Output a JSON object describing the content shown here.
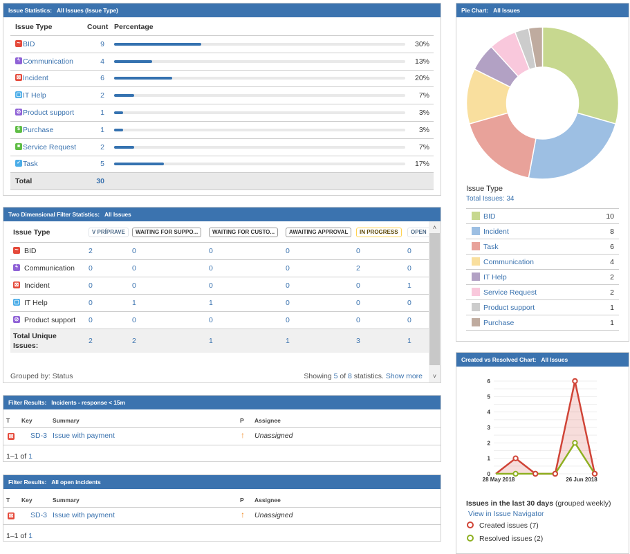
{
  "colors": {
    "header": "#3b73af",
    "link": "#3b73af",
    "bar": "#3572b0",
    "created": "#d04437",
    "resolved": "#8eb021"
  },
  "issue_statistics": {
    "title": "Issue Statistics:",
    "subtitle": "All Issues (Issue Type)",
    "columns": [
      "Issue Type",
      "Count",
      "Percentage"
    ],
    "rows": [
      {
        "type": "BID",
        "icon": "bid",
        "count": "9",
        "pct": "30%",
        "fraction": 0.3
      },
      {
        "type": "Communication",
        "icon": "communication",
        "count": "4",
        "pct": "13%",
        "fraction": 0.13
      },
      {
        "type": "Incident",
        "icon": "incident",
        "count": "6",
        "pct": "20%",
        "fraction": 0.2
      },
      {
        "type": "IT Help",
        "icon": "it-help",
        "count": "2",
        "pct": "7%",
        "fraction": 0.07
      },
      {
        "type": "Product support",
        "icon": "product-support",
        "count": "1",
        "pct": "3%",
        "fraction": 0.03
      },
      {
        "type": "Purchase",
        "icon": "purchase",
        "count": "1",
        "pct": "3%",
        "fraction": 0.03
      },
      {
        "type": "Service Request",
        "icon": "service-request",
        "count": "2",
        "pct": "7%",
        "fraction": 0.07
      },
      {
        "type": "Task",
        "icon": "task",
        "count": "5",
        "pct": "17%",
        "fraction": 0.17
      }
    ],
    "total_label": "Total",
    "total": "30"
  },
  "two_dimensional": {
    "title": "Two Dimensional Filter Statistics:",
    "subtitle": "All Issues",
    "row_header": "Issue Type",
    "statuses": [
      {
        "label": "V PRÍPRAVE",
        "style": "default"
      },
      {
        "label": "WAITING FOR SUPPO...",
        "style": "dark"
      },
      {
        "label": "WAITING FOR CUSTO...",
        "style": "dark"
      },
      {
        "label": "AWAITING APPROVAL",
        "style": "dark"
      },
      {
        "label": "IN PROGRESS",
        "style": "yellow"
      },
      {
        "label": "OPEN",
        "style": "default"
      }
    ],
    "rows": [
      {
        "type": "BID",
        "icon": "bid",
        "values": [
          "2",
          "0",
          "0",
          "0",
          "0",
          "0"
        ]
      },
      {
        "type": "Communication",
        "icon": "communication",
        "values": [
          "0",
          "0",
          "0",
          "0",
          "2",
          "0"
        ]
      },
      {
        "type": "Incident",
        "icon": "incident",
        "values": [
          "0",
          "0",
          "0",
          "0",
          "0",
          "1"
        ]
      },
      {
        "type": "IT Help",
        "icon": "it-help",
        "values": [
          "0",
          "1",
          "1",
          "0",
          "0",
          "0"
        ]
      },
      {
        "type": "Product support",
        "icon": "product-support",
        "values": [
          "0",
          "0",
          "0",
          "0",
          "0",
          "0"
        ]
      }
    ],
    "total_label_1": "Total Unique",
    "total_label_2": "Issues:",
    "totals": [
      "2",
      "2",
      "1",
      "1",
      "3",
      "1"
    ],
    "grouped_by": "Grouped by: Status",
    "showing_prefix": "Showing ",
    "showing_count": "5",
    "showing_of": " of ",
    "showing_total": "8",
    "showing_suffix": " statistics. ",
    "show_more": "Show more"
  },
  "filter_results": [
    {
      "title": "Filter Results:",
      "subtitle": "Incidents - response < 15m",
      "columns": {
        "t": "T",
        "key": "Key",
        "summary": "Summary",
        "p": "P",
        "assignee": "Assignee"
      },
      "rows": [
        {
          "icon": "incident",
          "key": "SD-3",
          "summary": "Issue with payment",
          "priority": "high",
          "assignee": "Unassigned"
        }
      ],
      "paging_range": "1–1 of ",
      "paging_total": "1"
    },
    {
      "title": "Filter Results:",
      "subtitle": "All open incidents",
      "columns": {
        "t": "T",
        "key": "Key",
        "summary": "Summary",
        "p": "P",
        "assignee": "Assignee"
      },
      "rows": [
        {
          "icon": "incident",
          "key": "SD-3",
          "summary": "Issue with payment",
          "priority": "high",
          "assignee": "Unassigned"
        }
      ],
      "paging_range": "1–1 of ",
      "paging_total": "1"
    }
  ],
  "pie_chart": {
    "title": "Pie Chart:",
    "subtitle": "All Issues",
    "legend_title": "Issue Type",
    "total_label": "Total Issues: 34",
    "chart_data": {
      "type": "pie",
      "donut": true,
      "title": "Issue Type",
      "total": 34,
      "categories": [
        "BID",
        "Incident",
        "Task",
        "Communication",
        "IT Help",
        "Service Request",
        "Product support",
        "Purchase"
      ],
      "values": [
        10,
        8,
        6,
        4,
        2,
        2,
        1,
        1
      ],
      "colors": [
        "#c7d88f",
        "#9dbfe3",
        "#e8a29a",
        "#f9df9e",
        "#b2a1c4",
        "#f9c8dc",
        "#cccccc",
        "#bfab9f"
      ]
    }
  },
  "created_vs_resolved": {
    "title": "Created vs Resolved Chart:",
    "subtitle": "All Issues",
    "legend_heading": "Issues in the last 30 days",
    "legend_heading_note": " (grouped weekly)",
    "navigator_link": "View in Issue Navigator",
    "created_label": "Created issues (7)",
    "resolved_label": "Resolved issues (2)",
    "chart_data": {
      "type": "line",
      "x": [
        "28 May 2018",
        "",
        "",
        "",
        "",
        "26 Jun 2018"
      ],
      "x_tick_labels": [
        "28 May 2018",
        "26 Jun 2018"
      ],
      "x_tick_index": [
        0,
        4
      ],
      "series": [
        {
          "name": "Created issues (7)",
          "values": [
            0,
            1,
            0,
            0,
            6,
            0
          ],
          "color": "#d04437"
        },
        {
          "name": "Resolved issues (2)",
          "values": [
            0,
            0,
            0,
            0,
            2,
            0
          ],
          "color": "#8eb021"
        }
      ],
      "ylim": [
        0,
        6
      ],
      "yticks": [
        0,
        1,
        2,
        3,
        4,
        5,
        6
      ],
      "grid": true,
      "area_between": true
    }
  }
}
